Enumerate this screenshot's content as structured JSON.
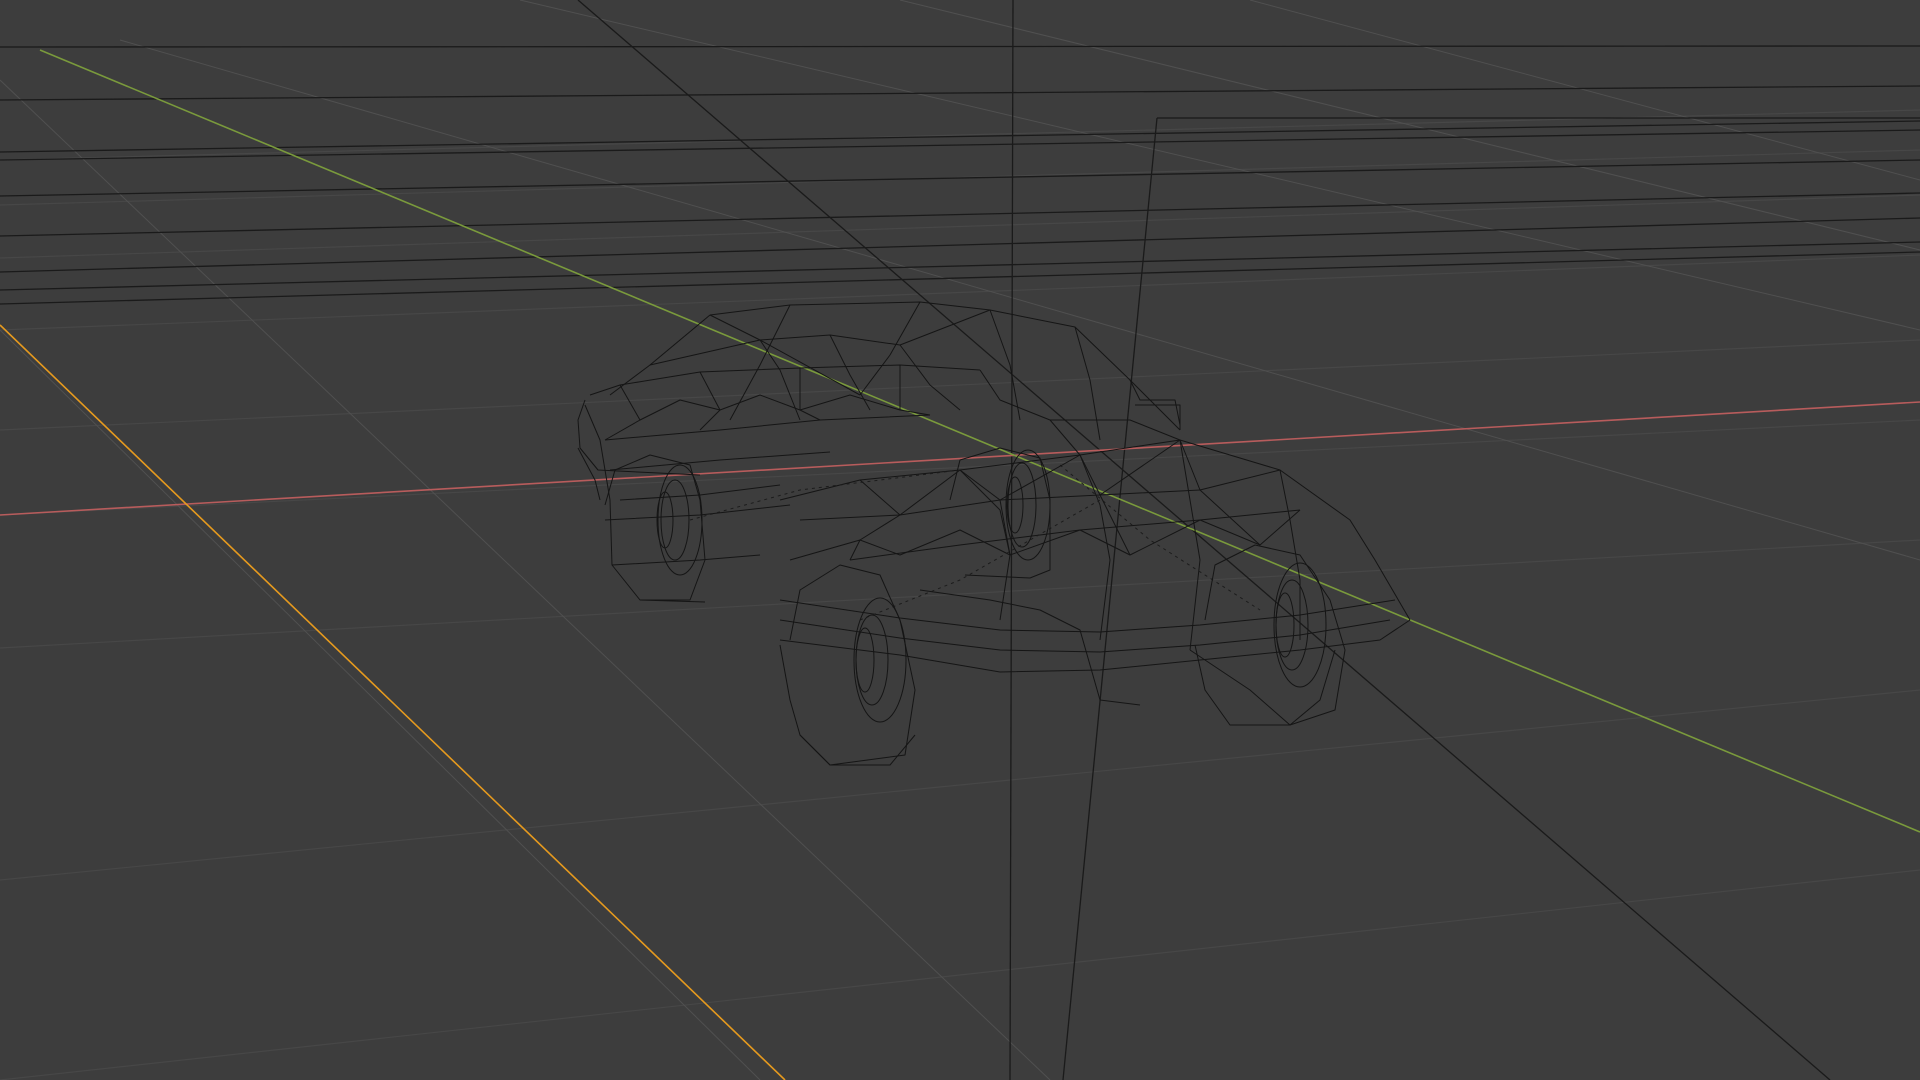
{
  "viewport": {
    "background": "#3d3d3d",
    "mode": "wireframe",
    "object": "car-mesh"
  },
  "axes": {
    "x_color": "#b85c5c",
    "y_color": "#7a9a3c",
    "selected_edge_color": "#e69a1e"
  },
  "colors": {
    "grid_major": "#474747",
    "grid_minor": "#505050",
    "wire": "#151515"
  }
}
